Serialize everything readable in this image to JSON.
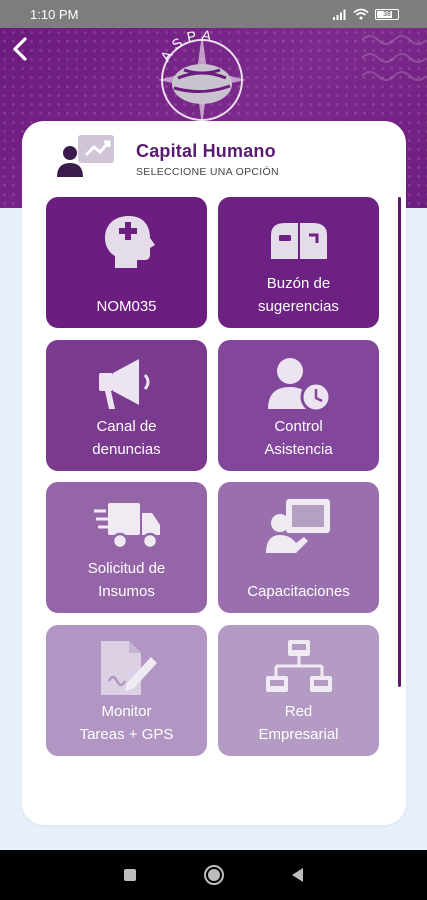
{
  "status_bar": {
    "time": "1:10 PM",
    "battery": "38"
  },
  "header": {
    "logo_text": "ASPA"
  },
  "card": {
    "title": "Capital Humano",
    "subtitle": "SELECCIONE UNA OPCIÓN"
  },
  "tiles": [
    {
      "line1": "NOM035",
      "line2": "",
      "icon": "head-plus-icon",
      "color": "#6b1d80"
    },
    {
      "line1": "Buzón de",
      "line2": "sugerencias",
      "icon": "mailbox-icon",
      "color": "#6d2183"
    },
    {
      "line1": "Canal de",
      "line2": "denuncias",
      "icon": "megaphone-icon",
      "color": "#7a3a8e"
    },
    {
      "line1": "Control",
      "line2": "Asistencia",
      "icon": "user-clock-icon",
      "color": "#82479a"
    },
    {
      "line1": "Solicitud de",
      "line2": "Insumos",
      "icon": "delivery-truck-icon",
      "color": "#9466a8"
    },
    {
      "line1": "Capacitaciones",
      "line2": "",
      "icon": "trainer-board-icon",
      "color": "#9a6fad"
    },
    {
      "line1": "Monitor",
      "line2": "Tareas + GPS",
      "icon": "document-sign-icon",
      "color": "#b195c2"
    },
    {
      "line1": "Red",
      "line2": "Empresarial",
      "icon": "network-icon",
      "color": "#b39bc4"
    }
  ],
  "colors": {
    "header": "#6b1a7d",
    "title": "#5a1b6e",
    "background": "#e8f1fb"
  }
}
